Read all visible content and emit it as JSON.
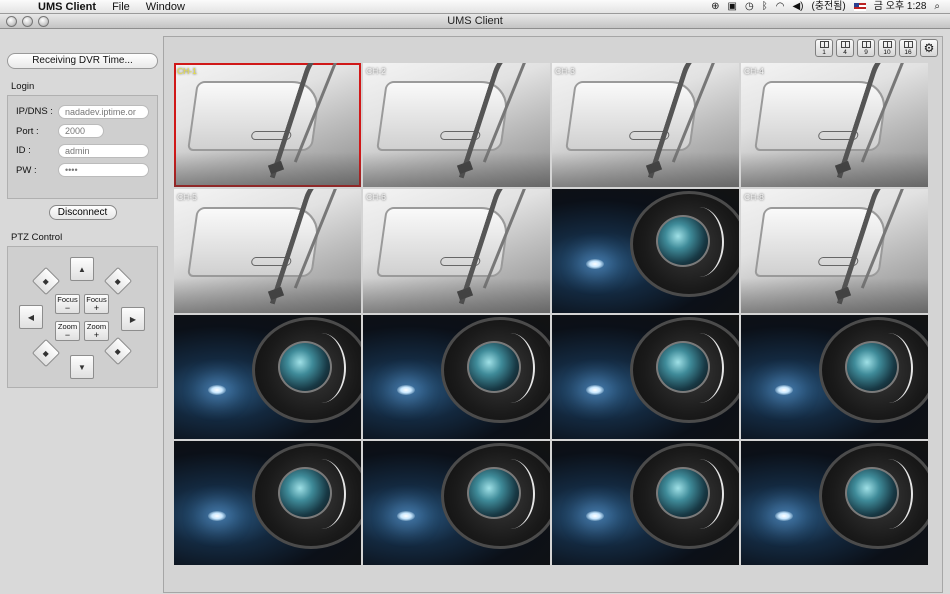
{
  "menubar": {
    "app_name": "UMS Client",
    "menus": [
      "File",
      "Window"
    ],
    "input_source": "(충전됨)",
    "clock": "금 오후 1:28"
  },
  "window": {
    "title": "UMS Client"
  },
  "status": {
    "text": "Receiving DVR Time..."
  },
  "login": {
    "group_label": "Login",
    "fields": [
      {
        "label": "IP/DNS :",
        "value": "nadadev.iptime.or"
      },
      {
        "label": "Port :",
        "value": "2000"
      },
      {
        "label": "ID :",
        "value": "admin"
      },
      {
        "label": "PW :",
        "value": "••••"
      }
    ],
    "disconnect_label": "Disconnect"
  },
  "ptz": {
    "group_label": "PTZ Control",
    "focus_label": "Focus",
    "zoom_label": "Zoom",
    "minus": "−",
    "plus": "+"
  },
  "layout_buttons": [
    "1",
    "4",
    "9",
    "10",
    "16"
  ],
  "channels": [
    {
      "label": "CH-1",
      "feed": "car",
      "selected": true
    },
    {
      "label": "CH-2",
      "feed": "car"
    },
    {
      "label": "CH-3",
      "feed": "car"
    },
    {
      "label": "CH-4",
      "feed": "car"
    },
    {
      "label": "CH-5",
      "feed": "car"
    },
    {
      "label": "CH-6",
      "feed": "car"
    },
    {
      "label": "",
      "feed": "lens"
    },
    {
      "label": "CH-8",
      "feed": "car"
    },
    {
      "label": "",
      "feed": "lens"
    },
    {
      "label": "",
      "feed": "lens"
    },
    {
      "label": "",
      "feed": "lens"
    },
    {
      "label": "",
      "feed": "lens"
    },
    {
      "label": "",
      "feed": "lens"
    },
    {
      "label": "",
      "feed": "lens"
    },
    {
      "label": "",
      "feed": "lens"
    },
    {
      "label": "",
      "feed": "lens"
    }
  ],
  "colors": {
    "selected_border": "#d01818",
    "selected_label": "#e8e040"
  }
}
